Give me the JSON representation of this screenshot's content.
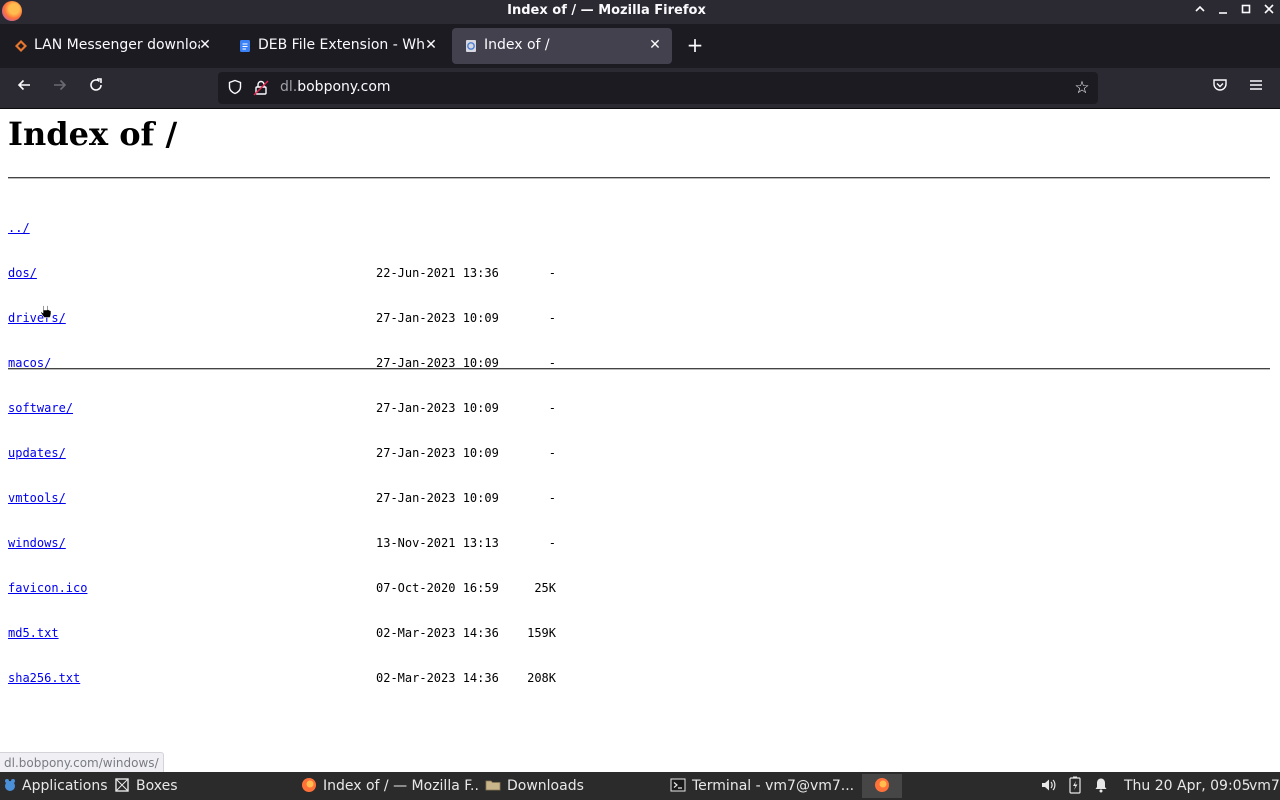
{
  "window": {
    "title": "Index of / — Mozilla Firefox"
  },
  "tabs": [
    {
      "label": "LAN Messenger downloa",
      "active": false,
      "favicon": "lan-messenger-icon"
    },
    {
      "label": "DEB File Extension - Wha",
      "active": false,
      "favicon": "document-icon"
    },
    {
      "label": "Index of /",
      "active": true,
      "favicon": "page-icon"
    }
  ],
  "urlbar": {
    "url_prefix": "dl.",
    "url_domain": "bobpony.com"
  },
  "page": {
    "heading": "Index of /",
    "parent_link": "../",
    "entries": [
      {
        "name": "dos/",
        "date": "22-Jun-2021 13:36",
        "size": "-"
      },
      {
        "name": "drivers/",
        "date": "27-Jan-2023 10:09",
        "size": "-"
      },
      {
        "name": "macos/",
        "date": "27-Jan-2023 10:09",
        "size": "-"
      },
      {
        "name": "software/",
        "date": "27-Jan-2023 10:09",
        "size": "-"
      },
      {
        "name": "updates/",
        "date": "27-Jan-2023 10:09",
        "size": "-"
      },
      {
        "name": "vmtools/",
        "date": "27-Jan-2023 10:09",
        "size": "-"
      },
      {
        "name": "windows/",
        "date": "13-Nov-2021 13:13",
        "size": "-"
      },
      {
        "name": "favicon.ico",
        "date": "07-Oct-2020 16:59",
        "size": "25K"
      },
      {
        "name": "md5.txt",
        "date": "02-Mar-2023 14:36",
        "size": "159K"
      },
      {
        "name": "sha256.txt",
        "date": "02-Mar-2023 14:36",
        "size": "208K"
      }
    ]
  },
  "status_link": "dl.bobpony.com/windows/",
  "taskbar": {
    "applications": "Applications",
    "boxes": "Boxes",
    "firefox_window": "Index of / — Mozilla F...",
    "downloads": "Downloads",
    "terminal": "Terminal - vm7@vm7...",
    "clock": "Thu 20 Apr, 09:05",
    "user": "vm7"
  },
  "colors": {
    "link": "#0000ee",
    "tab_active": "#42414d",
    "chrome_dark": "#1c1b22",
    "chrome": "#2b2a33"
  }
}
